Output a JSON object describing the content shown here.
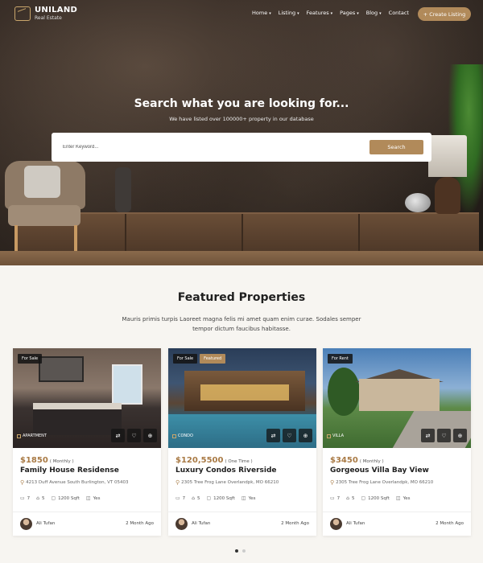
{
  "brand": {
    "name": "UNILAND",
    "tagline": "Real Estate"
  },
  "nav": {
    "items": [
      {
        "label": "Home",
        "has_dropdown": true
      },
      {
        "label": "Listing",
        "has_dropdown": true
      },
      {
        "label": "Features",
        "has_dropdown": true
      },
      {
        "label": "Pages",
        "has_dropdown": true
      },
      {
        "label": "Blog",
        "has_dropdown": true
      },
      {
        "label": "Contact",
        "has_dropdown": false
      }
    ],
    "cta": "+ Create Listing"
  },
  "hero": {
    "title": "Search what you are looking for...",
    "subtitle": "We have listed over 100000+ property in our database",
    "search_placeholder": "Enter Keyword...",
    "search_button": "Search"
  },
  "featured": {
    "title": "Featured Properties",
    "description": "Mauris primis turpis Laoreet magna felis mi amet quam enim curae. Sodales semper tempor dictum faucibus habitasse."
  },
  "properties": [
    {
      "badges": [
        "For Sale"
      ],
      "type": "APARTMENT",
      "price": "$1850",
      "period": "( Monthly )",
      "name": "Family House Residense",
      "address": "4213 Duff Avenue South Burlington, VT 05403",
      "beds": "7",
      "baths": "5",
      "area": "1200 Sqft",
      "garage": "Yes",
      "agent": "Ali Tufan",
      "posted": "2 Month Ago"
    },
    {
      "badges": [
        "For Sale",
        "Featured"
      ],
      "type": "CONDO",
      "price": "$120,5500",
      "period": "( One Time )",
      "name": "Luxury Condos Riverside",
      "address": "2305 Tree Frog Lane Overlandpk, MO 66210",
      "beds": "7",
      "baths": "5",
      "area": "1200 Sqft",
      "garage": "Yes",
      "agent": "Ali Tufan",
      "posted": "2 Month Ago"
    },
    {
      "badges": [
        "For Rent"
      ],
      "type": "VILLA",
      "price": "$3450",
      "period": "( Monthly )",
      "name": "Gorgeous Villa Bay View",
      "address": "2305 Tree Frog Lane Overlandpk, MO 66210",
      "beds": "7",
      "baths": "5",
      "area": "1200 Sqft",
      "garage": "Yes",
      "agent": "Ali Tufan",
      "posted": "2 Month Ago"
    }
  ],
  "colors": {
    "accent": "#b18a5a",
    "price": "#a97a45"
  },
  "pagination": {
    "pages": 2,
    "active": 1
  }
}
